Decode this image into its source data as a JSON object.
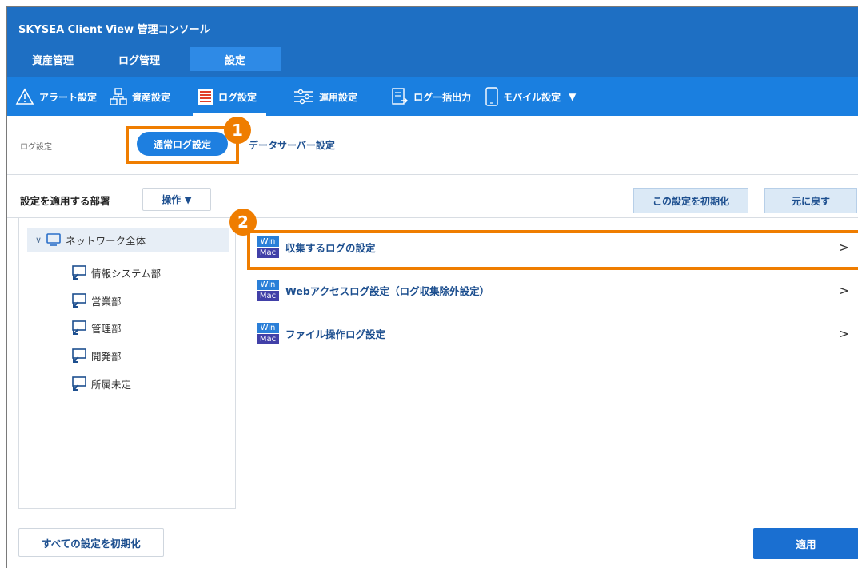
{
  "app": {
    "title": "SKYSEA Client View 管理コンソール"
  },
  "main_tabs": [
    {
      "label": "資産管理"
    },
    {
      "label": "ログ管理"
    },
    {
      "label": "設定"
    }
  ],
  "sub_menu": [
    {
      "label": "アラート設定",
      "icon": "alert-triangle-icon"
    },
    {
      "label": "資産設定",
      "icon": "hierarchy-icon"
    },
    {
      "label": "ログ設定",
      "icon": "log-sheet-icon"
    },
    {
      "label": "運用設定",
      "icon": "sliders-icon"
    },
    {
      "label": "ログ一括出力",
      "icon": "export-icon"
    },
    {
      "label": "モバイル設定",
      "icon": "mobile-icon"
    },
    {
      "label": "▼",
      "icon": "caret-down-icon"
    }
  ],
  "breadcrumb": {
    "label": "ログ設定",
    "tabs": [
      {
        "label": "通常ログ設定",
        "active": true
      },
      {
        "label": "データサーバー設定",
        "active": false
      }
    ]
  },
  "callouts": {
    "one": "1",
    "two": "2"
  },
  "actions": {
    "dept_title": "設定を適用する部署",
    "operation_label": "操作 ▼",
    "reset_label": "この設定を初期化",
    "undo_label": "元に戻す"
  },
  "tree": {
    "root": {
      "label": "ネットワーク全体",
      "chevron": "∨"
    },
    "children": [
      {
        "label": "情報システム部"
      },
      {
        "label": "営業部"
      },
      {
        "label": "管理部"
      },
      {
        "label": "開発部"
      },
      {
        "label": "所属未定"
      }
    ]
  },
  "settings": [
    {
      "label": "収集するログの設定",
      "os_win": "Win",
      "os_mac": "Mac",
      "arrow": ">"
    },
    {
      "label": "Webアクセスログ設定（ログ収集除外設定）",
      "os_win": "Win",
      "os_mac": "Mac",
      "arrow": ">"
    },
    {
      "label": "ファイル操作ログ設定",
      "os_win": "Win",
      "os_mac": "Mac",
      "arrow": ">"
    }
  ],
  "footer": {
    "reset_all_label": "すべての設定を初期化",
    "apply_label": "適用"
  },
  "colors": {
    "header_blue": "#1e6fc3",
    "subbar_blue": "#1a7fe0",
    "highlight_orange": "#ef7d00",
    "os_win": "#2a7fd8",
    "os_mac": "#4140a8"
  }
}
